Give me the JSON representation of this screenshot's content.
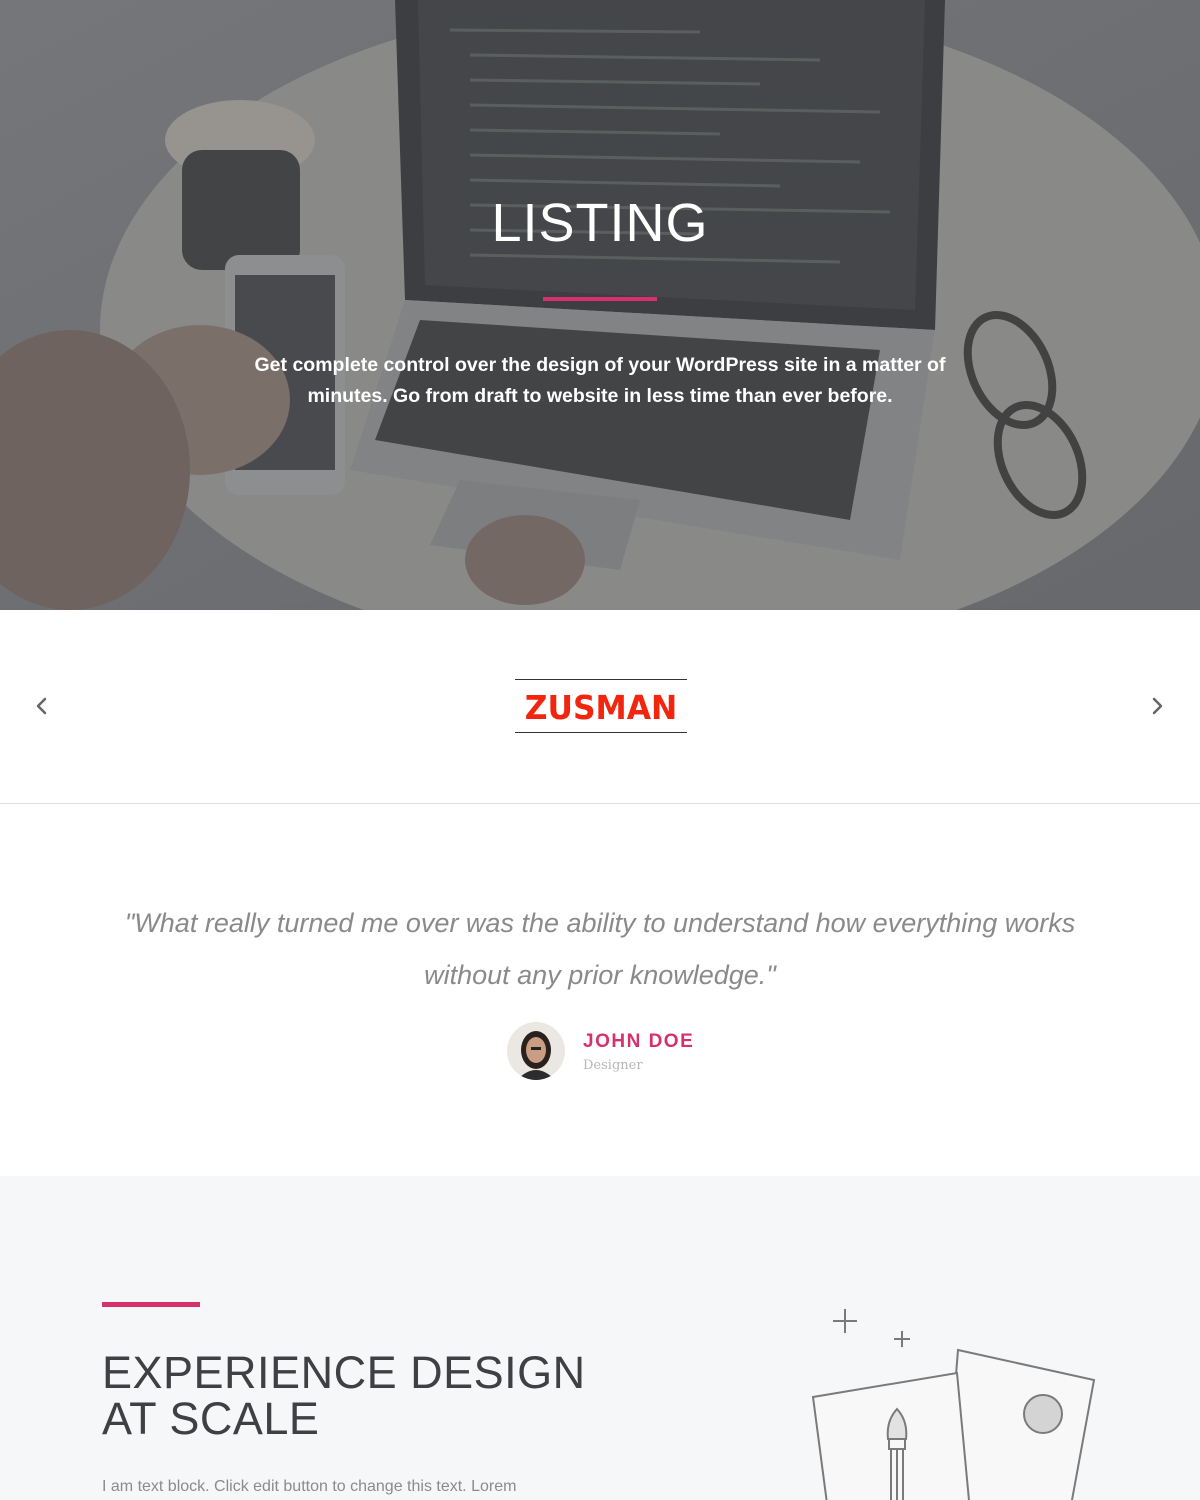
{
  "hero": {
    "title": "LISTING",
    "description": "Get complete control over the design of your WordPress site in a matter of minutes. Go from draft to website in less time than ever before.",
    "accent_color": "#d6306f"
  },
  "slider": {
    "logo_text": "ZUSMAN",
    "logo_color": "#f2250f",
    "prev_icon": "chevron-left-icon",
    "next_icon": "chevron-right-icon"
  },
  "testimonial": {
    "quote": "\"What really turned me over was the ability to understand how everything works without any prior knowledge.\"",
    "author_name": "JOHN DOE",
    "author_role": "Designer"
  },
  "feature": {
    "title_line1": "EXPERIENCE DESIGN",
    "title_line2": "AT SCALE",
    "text": "I am text block. Click edit button to change this text. Lorem",
    "illustration_icon": "design-cards-illustration-icon"
  }
}
